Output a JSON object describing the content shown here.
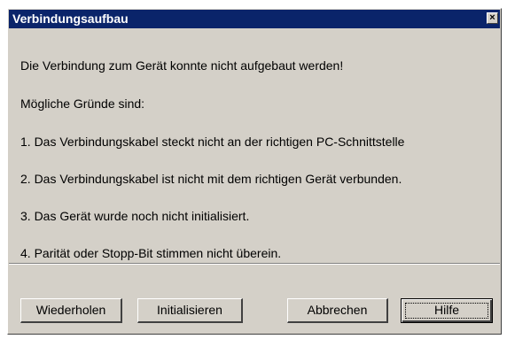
{
  "dialog": {
    "title": "Verbindungsaufbau",
    "close_glyph": "×",
    "message": "Die Verbindung zum Gerät konnte nicht aufgebaut werden!",
    "reasons_heading": "Mögliche Gründe sind:",
    "reasons": [
      "1. Das Verbindungskabel steckt nicht an der richtigen PC-Schnittstelle",
      "2. Das Verbindungskabel ist nicht mit dem richtigen Gerät verbunden.",
      "3. Das Gerät wurde noch nicht initialisiert.",
      "4. Parität oder Stopp-Bit stimmen nicht überein."
    ],
    "buttons": {
      "retry": "Wiederholen",
      "initialize": "Initialisieren",
      "cancel": "Abbrechen",
      "help": "Hilfe"
    }
  },
  "colors": {
    "titlebar": "#0a246a",
    "title_text": "#ffffff",
    "face": "#d4d0c8"
  }
}
